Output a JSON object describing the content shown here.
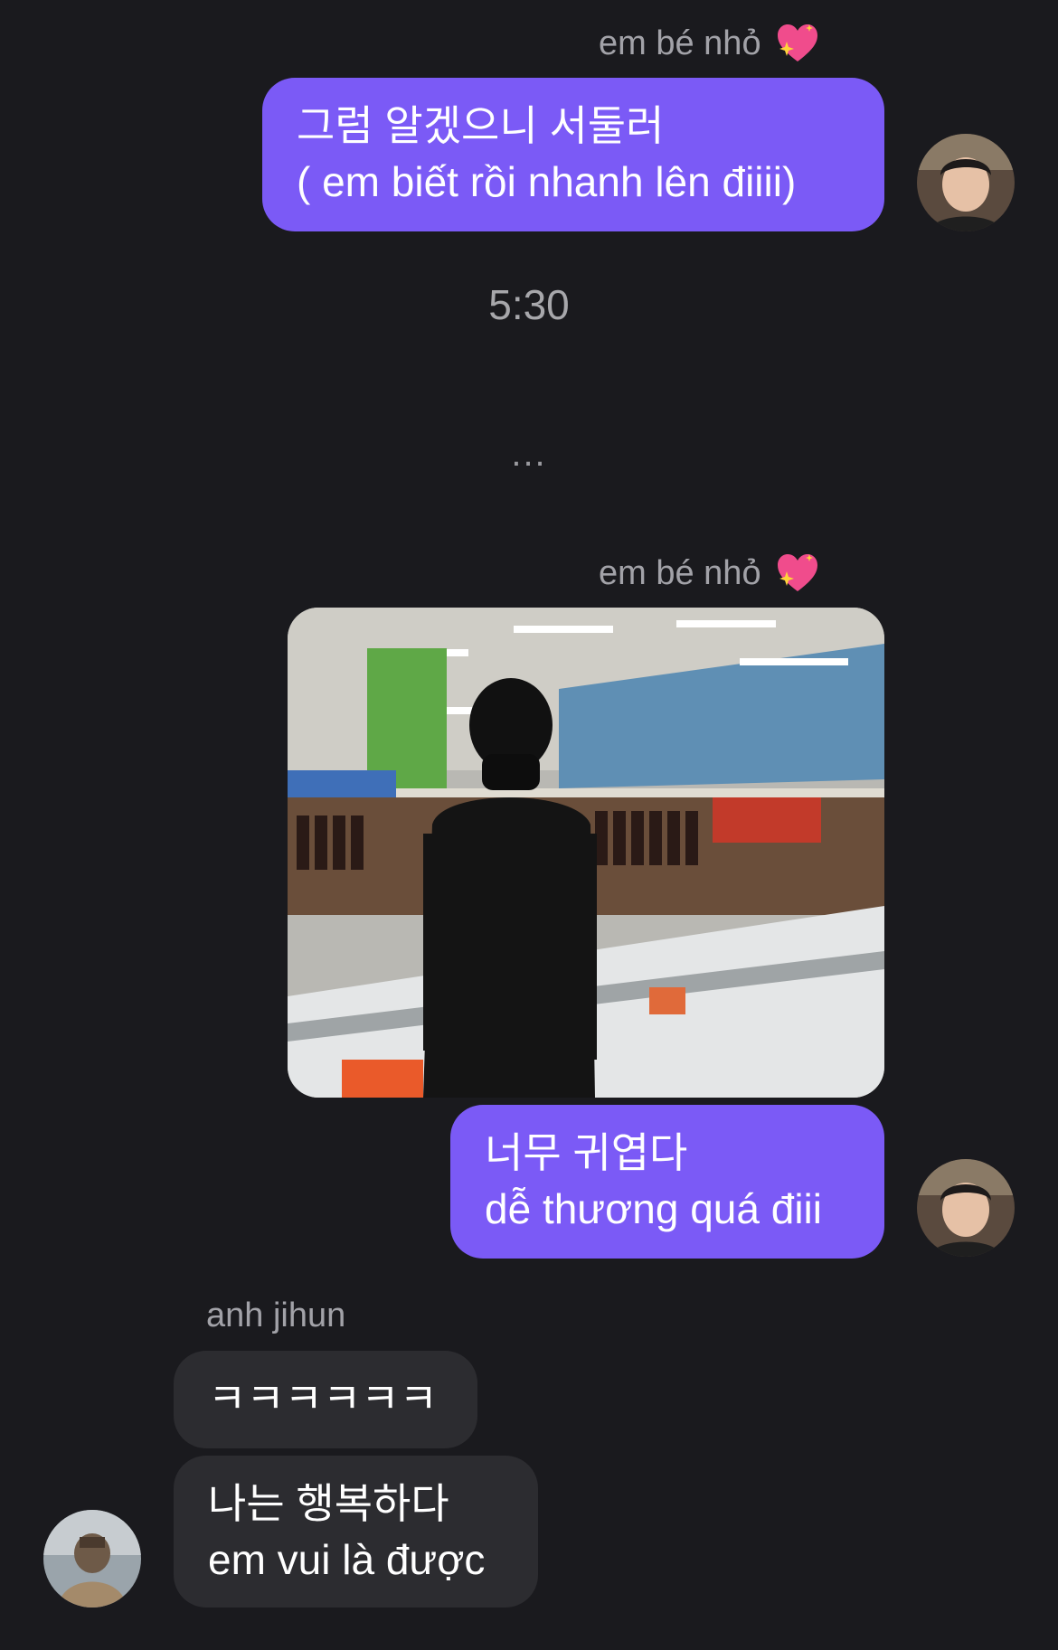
{
  "conversation": {
    "group1": {
      "sender_name": "em bé nhỏ",
      "message": "그럼 알겠으니 서둘러\n( em biết rồi nhanh lên điiii)"
    },
    "timestamp": "5:30",
    "typing_indicator": "...",
    "group2": {
      "sender_name": "em bé nhỏ",
      "message": "너무 귀엽다\ndễ thương quá điii"
    },
    "group3": {
      "sender_name": "anh jihun",
      "message1": "ㅋㅋㅋㅋㅋㅋ",
      "message2": "나는 행복하다\nem vui là được"
    }
  },
  "colors": {
    "background": "#1a1a1e",
    "outgoing_bubble": "#7b5af6",
    "incoming_bubble": "#2c2c30",
    "muted_text": "#a2a2a8"
  },
  "icons": {
    "sender_heart": "sparkling-heart-icon"
  }
}
